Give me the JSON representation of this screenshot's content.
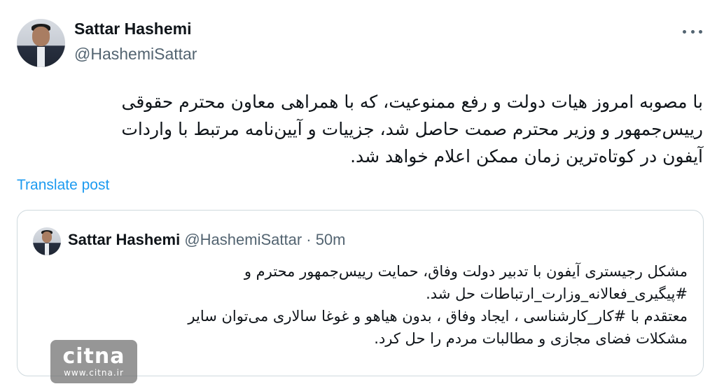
{
  "post": {
    "author_name": "Sattar Hashemi",
    "author_handle": "@HashemiSattar",
    "text": "با مصوبه امروز هیات دولت و رفع ممنوعیت، که با همراهی معاون محترم حقوقی\nرییس‌جمهور و وزیر محترم صمت حاصل شد، جزییات و آیین‌نامه مرتبط با واردات\nآیفون در کوتاه‌ترین زمان ممکن اعلام خواهد شد.",
    "translate_label": "Translate post",
    "more_icon": "more-horizontal-icon"
  },
  "quote": {
    "author_name": "Sattar Hashemi",
    "meta": "@HashemiSattar · 50m",
    "text": "مشکل رجیستری آیفون با تدبیر دولت  وفاق، حمایت  رییس‌جمهور محترم و\n#پیگیری_فعالانه_وزارت_ارتباطات حل شد.\nمعتقدم با #کار_کارشناسی ، ایجاد وفاق ، بدون هیاهو و غوغا سالاری می‌توان سایر\nمشکلات فضای مجازی و مطالبات مردم را حل کرد."
  },
  "watermark": {
    "logo": "citna",
    "url": "www.citna.ir"
  },
  "colors": {
    "primary_text": "#0f1419",
    "secondary_text": "#536471",
    "link": "#1d9bf0",
    "border": "#cfd9de"
  }
}
